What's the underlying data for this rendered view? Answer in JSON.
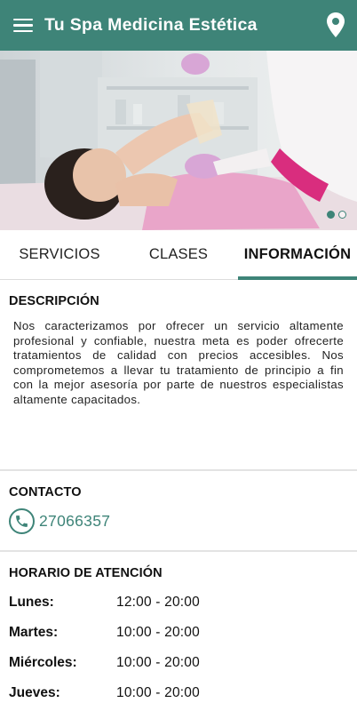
{
  "app": {
    "title": "Tu Spa Medicina Estética",
    "menu_icon": "hamburger-menu-icon",
    "location_icon": "map-pin-icon",
    "accent_color": "#3e8478"
  },
  "hero": {
    "image_description": "spa-waxing-treatment-photo",
    "carousel": {
      "total": 2,
      "active_index": 0
    }
  },
  "tabs": [
    {
      "label": "SERVICIOS",
      "active": false
    },
    {
      "label": "CLASES",
      "active": false
    },
    {
      "label": "INFORMACIÓN",
      "active": true
    }
  ],
  "description": {
    "title": "DESCRIPCIÓN",
    "text": "Nos caracterizamos por ofrecer un servicio altamente profesional y confiable, nuestra meta es poder ofrecerte tratamientos de calidad con precios accesibles. Nos comprometemos a llevar tu tratamiento de principio a fin con la mejor asesoría por parte de nuestros especialistas altamente capacitados."
  },
  "contact": {
    "title": "CONTACTO",
    "phone": "27066357",
    "phone_icon": "phone-icon"
  },
  "hours": {
    "title": "HORARIO DE ATENCIÓN",
    "rows": [
      {
        "day": "Lunes:",
        "time": "12:00 - 20:00"
      },
      {
        "day": "Martes:",
        "time": "10:00 - 20:00"
      },
      {
        "day": "Miércoles:",
        "time": "10:00 - 20:00"
      },
      {
        "day": "Jueves:",
        "time": "10:00 - 20:00"
      }
    ]
  }
}
